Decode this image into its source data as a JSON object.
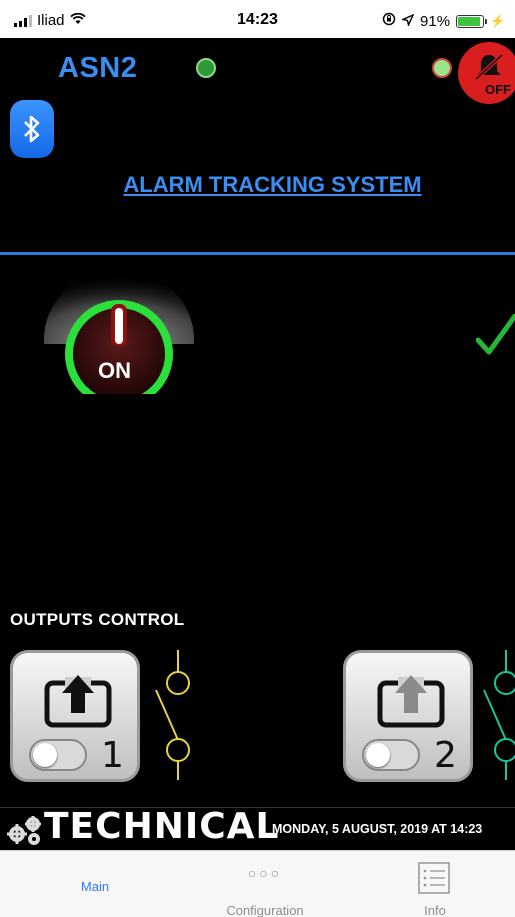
{
  "status_bar": {
    "carrier": "Iliad",
    "time": "14:23",
    "battery": "91%",
    "battery_level": 0.91
  },
  "header": {
    "device_name": "ASN2",
    "alarm_button_label": "OFF"
  },
  "title": "ALARM TRACKING SYSTEM",
  "power_button": {
    "label": "ON"
  },
  "outputs": {
    "title": "OUTPUTS  CONTROL",
    "items": [
      {
        "number": "1",
        "switch_color": "#e9d33a"
      },
      {
        "number": "2",
        "switch_color": "#19c79a"
      }
    ]
  },
  "banner": {
    "brand": "TECHNICAL",
    "datetime": "MONDAY, 5 AUGUST, 2019  AT  14:23"
  },
  "tabbar": {
    "tabs": [
      {
        "label": "Main",
        "icon": "none",
        "active": true
      },
      {
        "label": "Configuration",
        "icon": "dots-icon",
        "active": false
      },
      {
        "label": "Info",
        "icon": "list-icon",
        "active": false
      }
    ]
  },
  "colors": {
    "accent_blue": "#3a8ef2",
    "alarm_red": "#d81e1e",
    "power_green": "#2be03a",
    "check_green": "#25b735"
  }
}
